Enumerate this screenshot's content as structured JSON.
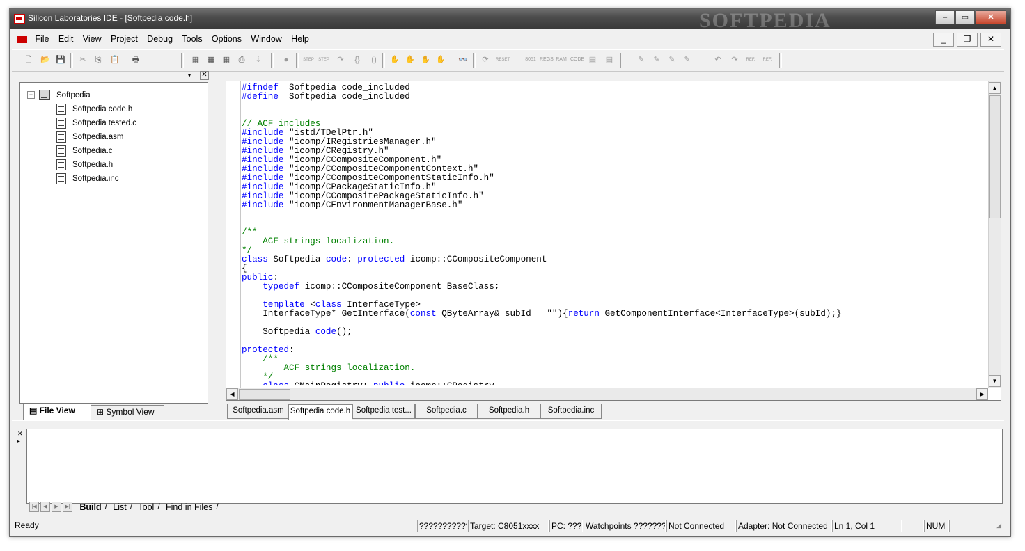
{
  "window": {
    "title": "Silicon Laboratories IDE - [Softpedia code.h]",
    "watermark": "SOFTPEDIA",
    "caption_buttons": {
      "minimize": "‒",
      "maximize": "▭",
      "close": "✕"
    }
  },
  "menu": {
    "items": [
      "File",
      "Edit",
      "View",
      "Project",
      "Debug",
      "Tools",
      "Options",
      "Window",
      "Help"
    ],
    "mdi_buttons": {
      "minimize": "_",
      "restore": "❐",
      "close": "✕"
    }
  },
  "toolbar": {
    "step_label": "STEP",
    "reset_label": "RESET",
    "sfr_labels": [
      "8051",
      "REGS",
      "RAM",
      "CODE"
    ],
    "ref_label": "REF."
  },
  "project_tree": {
    "root": "Softpedia",
    "files": [
      "Softpedia code.h",
      "Softpedia tested.c",
      "Softpedia.asm",
      "Softpedia.c",
      "Softpedia.h",
      "Softpedia.inc"
    ]
  },
  "left_tabs": {
    "file_view": "File View",
    "symbol_view": "Symbol View"
  },
  "editor": {
    "lines": [
      [
        [
          "kw",
          "#ifndef"
        ],
        [
          "",
          "  Softpedia code_included"
        ]
      ],
      [
        [
          "kw",
          "#define"
        ],
        [
          "",
          "  Softpedia code_included"
        ]
      ],
      [],
      [],
      [
        [
          "cm",
          "// ACF includes"
        ]
      ],
      [
        [
          "kw",
          "#include"
        ],
        [
          "",
          " \"istd/TDelPtr.h\""
        ]
      ],
      [
        [
          "kw",
          "#include"
        ],
        [
          "",
          " \"icomp/IRegistriesManager.h\""
        ]
      ],
      [
        [
          "kw",
          "#include"
        ],
        [
          "",
          " \"icomp/CRegistry.h\""
        ]
      ],
      [
        [
          "kw",
          "#include"
        ],
        [
          "",
          " \"icomp/CCompositeComponent.h\""
        ]
      ],
      [
        [
          "kw",
          "#include"
        ],
        [
          "",
          " \"icomp/CCompositeComponentContext.h\""
        ]
      ],
      [
        [
          "kw",
          "#include"
        ],
        [
          "",
          " \"icomp/CCompositeComponentStaticInfo.h\""
        ]
      ],
      [
        [
          "kw",
          "#include"
        ],
        [
          "",
          " \"icomp/CPackageStaticInfo.h\""
        ]
      ],
      [
        [
          "kw",
          "#include"
        ],
        [
          "",
          " \"icomp/CCompositePackageStaticInfo.h\""
        ]
      ],
      [
        [
          "kw",
          "#include"
        ],
        [
          "",
          " \"icomp/CEnvironmentManagerBase.h\""
        ]
      ],
      [],
      [],
      [
        [
          "cm",
          "/**"
        ]
      ],
      [
        [
          "cm",
          "    ACF strings localization."
        ]
      ],
      [
        [
          "cm",
          "*/"
        ]
      ],
      [
        [
          "kw",
          "class"
        ],
        [
          "",
          " Softpedia "
        ],
        [
          "kw",
          "code"
        ],
        [
          "",
          ": "
        ],
        [
          "kw",
          "protected"
        ],
        [
          "",
          " icomp::CCompositeComponent"
        ]
      ],
      [
        [
          "",
          "{"
        ]
      ],
      [
        [
          "kw",
          "public"
        ],
        [
          "",
          ":"
        ]
      ],
      [
        [
          "",
          "    "
        ],
        [
          "kw",
          "typedef"
        ],
        [
          "",
          " icomp::CCompositeComponent BaseClass;"
        ]
      ],
      [],
      [
        [
          "",
          "    "
        ],
        [
          "kw",
          "template"
        ],
        [
          "",
          " <"
        ],
        [
          "kw",
          "class"
        ],
        [
          "",
          " InterfaceType>"
        ]
      ],
      [
        [
          "",
          "    InterfaceType* GetInterface("
        ],
        [
          "kw",
          "const"
        ],
        [
          "",
          " QByteArray& subId = \"\"){"
        ],
        [
          "kw",
          "return"
        ],
        [
          "",
          " GetComponentInterface<InterfaceType>(subId);}"
        ]
      ],
      [],
      [
        [
          "",
          "    Softpedia "
        ],
        [
          "kw",
          "code"
        ],
        [
          "",
          "();"
        ]
      ],
      [],
      [
        [
          "kw",
          "protected"
        ],
        [
          "",
          ":"
        ]
      ],
      [
        [
          "cm",
          "    /**"
        ]
      ],
      [
        [
          "cm",
          "        ACF strings localization."
        ]
      ],
      [
        [
          "cm",
          "    */"
        ]
      ],
      [
        [
          "",
          "    "
        ],
        [
          "kw",
          "class"
        ],
        [
          "",
          " CMainRegistry: "
        ],
        [
          "kw",
          "public"
        ],
        [
          "",
          " icomp::CRegistry"
        ]
      ]
    ]
  },
  "editor_tabs": [
    "Softpedia.asm",
    "Softpedia code.h",
    "Softpedia test...",
    "Softpedia.c",
    "Softpedia.h",
    "Softpedia.inc"
  ],
  "output_tabs": [
    "Build",
    "List",
    "Tool",
    "Find in Files"
  ],
  "status": {
    "ready": "Ready",
    "cells": [
      "?????????????",
      "Target: C8051xxxx",
      "PC: ????",
      "Watchpoints ????????",
      "Not Connected",
      "Adapter: Not Connected",
      "Ln 1, Col 1",
      "",
      "NUM",
      ""
    ]
  },
  "colors": {
    "keyword": "#0000ff",
    "comment": "#008000",
    "titlebar": "#4d4d4d"
  }
}
